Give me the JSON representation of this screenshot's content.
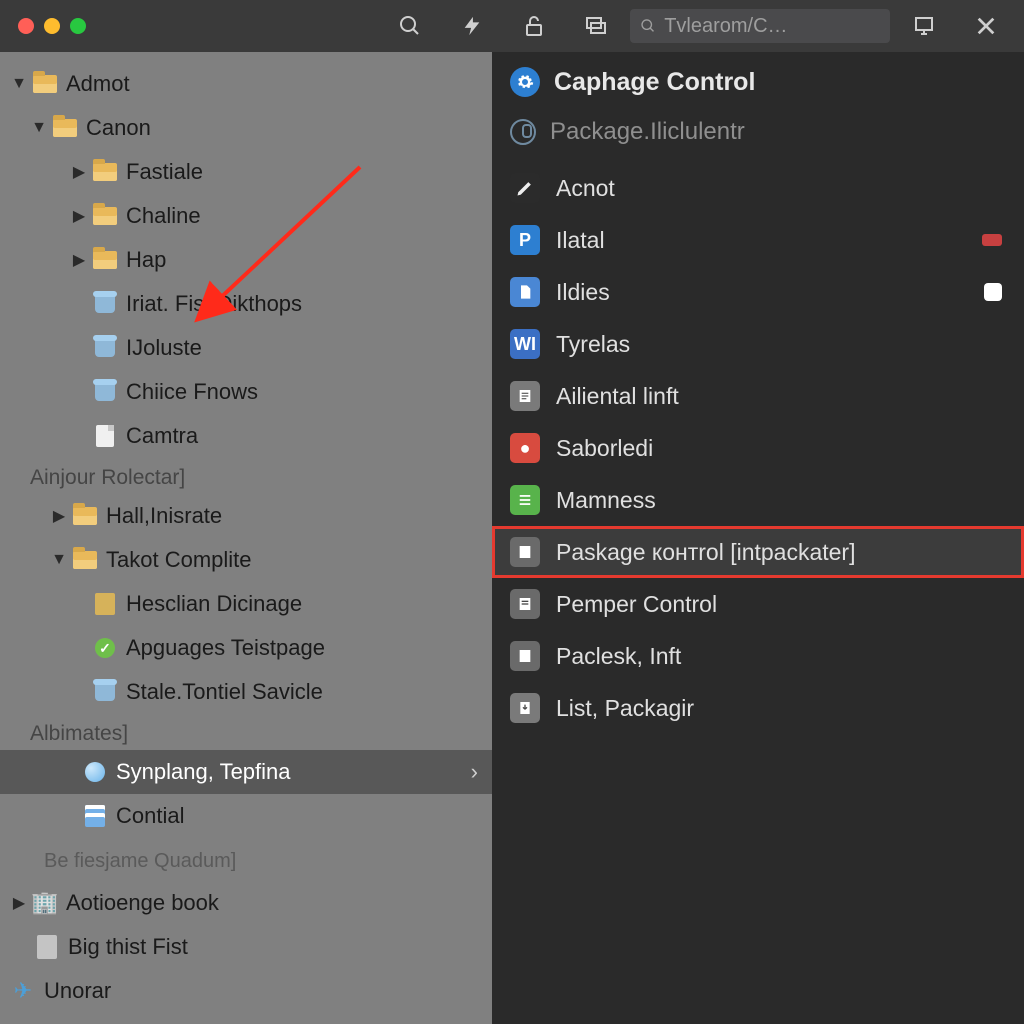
{
  "toolbar": {
    "search_placeholder": "Tvlearom/C…"
  },
  "sidebar": {
    "root": "Admot",
    "n1": "Canon",
    "n1a": "Fastiale",
    "n1b": "Chaline",
    "n1c": "Hap",
    "f1": "Iriat. Fist Dikthops",
    "f2": "IJoluste",
    "f3": "Chiice Fnows",
    "f4": "Camtra",
    "sec1": "Ainjour Rolectar]",
    "n2a": "Hall,Inisrate",
    "n2b": "Takot Complite",
    "f5": "Hesclian Dicinage",
    "f6": "Apguages Teistpage",
    "f7": "Stale.Tontiel Savicle",
    "sec2": "Albimates]",
    "sel": "Synplang, Tepfina",
    "f8": "Contial",
    "foot": "Be fiesjame Quadum]",
    "n3": "Aotioenge book",
    "f9": "Big thist Fist",
    "f10": "Unorar"
  },
  "panel": {
    "title": "Caphage Control",
    "subtitle": "Package.Iliclulentr",
    "items": [
      "Acnot",
      "Ilatal",
      "Ildies",
      "Tyrelas",
      "Ailiental linft",
      "Saborledi",
      "Mamness",
      "Paskage контrol [intpackater]",
      "Pemper Control",
      "Paclesk, Inft",
      "List, Packagir"
    ]
  }
}
